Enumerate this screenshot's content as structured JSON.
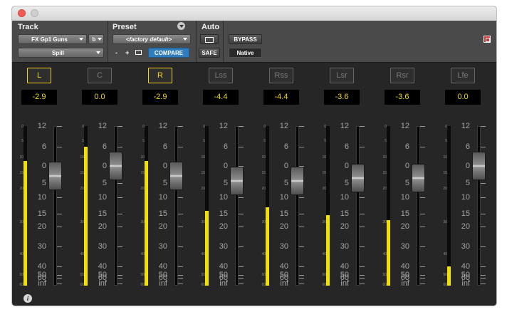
{
  "header": {
    "track_label": "Track",
    "preset_label": "Preset",
    "auto_label": "Auto",
    "track_name": "FX Gp1 Guns",
    "track_suffix": "b",
    "send_name": "Spill",
    "preset_name": "<factory default>",
    "minus_label": "-",
    "plus_label": "+",
    "compare_label": "COMPARE",
    "safe_label": "SAFE",
    "bypass_label": "BYPASS",
    "native_label": "Native"
  },
  "scale_ticks": [
    "12",
    "6",
    "0",
    "5",
    "10",
    "15",
    "20",
    "30",
    "40",
    "50",
    "60",
    "inf"
  ],
  "meter_ticks": [
    "0",
    "5",
    "10",
    "15",
    "20",
    "30",
    "40",
    "50",
    "60"
  ],
  "channels": [
    {
      "label": "L",
      "value": "-2.9",
      "active": true,
      "meter_level": 0.78
    },
    {
      "label": "C",
      "value": "0.0",
      "active": false,
      "meter_level": 0.87
    },
    {
      "label": "R",
      "value": "-2.9",
      "active": true,
      "meter_level": 0.78
    },
    {
      "label": "Lss",
      "value": "-4.4",
      "active": false,
      "meter_level": 0.47
    },
    {
      "label": "Rss",
      "value": "-4.4",
      "active": false,
      "meter_level": 0.49
    },
    {
      "label": "Lsr",
      "value": "-3.6",
      "active": false,
      "meter_level": 0.44
    },
    {
      "label": "Rsr",
      "value": "-3.6",
      "active": false,
      "meter_level": 0.41
    },
    {
      "label": "Lfe",
      "value": "0.0",
      "active": false,
      "meter_level": 0.12
    }
  ],
  "info_label": "i"
}
